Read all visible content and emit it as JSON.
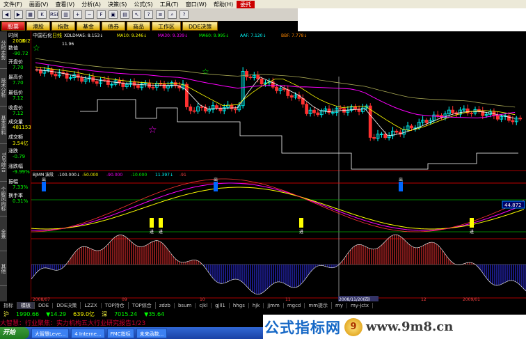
{
  "menubar": {
    "items": [
      "文件(F)",
      "画面(V)",
      "查看(V)",
      "分析(A)",
      "决策(S)",
      "公式(S)",
      "工具(T)",
      "窗口(W)",
      "帮助(H)",
      "委托"
    ],
    "active_index": 9
  },
  "toolbar": {
    "icons": [
      "back-icon",
      "forward-icon",
      "grid-icon",
      "kline-icon",
      "rsi-icon",
      "bar-chart-icon",
      "zoom-in-icon",
      "zoom-out-icon",
      "f10-icon",
      "screen-icon",
      "tile-icon",
      "pointer-icon",
      "news-icon",
      "calc-icon",
      "search-icon",
      "help-icon"
    ],
    "icon_labels": [
      "◀",
      "▶",
      "▦",
      "K",
      "RSI",
      "▥",
      "+",
      "−",
      "F",
      "▣",
      "▤",
      "↖",
      "?",
      "≡",
      "⌕",
      "?"
    ]
  },
  "tabs": {
    "items": [
      "股票",
      "港股",
      "指数",
      "基金",
      "债券",
      "商品",
      "工作区",
      "DDE决策"
    ],
    "active_index": 0
  },
  "leftpanel": {
    "rows": [
      {
        "label": "时间",
        "value": "2008"
      },
      {
        "label": "",
        "value": "10/27"
      },
      {
        "label": "数值",
        "value": "-90.72"
      },
      {
        "label": "开盘价",
        "value": "7.70"
      },
      {
        "label": "最高价",
        "value": "7.70"
      },
      {
        "label": "最低价",
        "value": "7.12"
      },
      {
        "label": "收盘价",
        "value": "7.12"
      },
      {
        "label": "成交量",
        "value": "481153"
      },
      {
        "label": "成交额",
        "value": "3.54亿"
      },
      {
        "label": "涨跌",
        "value": "-0.79"
      },
      {
        "label": "涨跌幅",
        "value": "-9.99%"
      },
      {
        "label": "振幅",
        "value": "7.33%"
      },
      {
        "label": "换手率",
        "value": "0.31%"
      }
    ],
    "side_tabs": [
      "分时走势",
      "技术分析",
      "基本资料",
      "TOP综合",
      "个股风向标",
      "全景",
      "其他"
    ]
  },
  "price_panel": {
    "stock": "中国石化",
    "period": "日线",
    "method": "XDLD",
    "ma_labels": [
      "MA5: 8.153↓",
      "MA10: 9.246↓",
      "MA30: 9.339↓",
      "MA60: 9.995↓",
      "AAF: 7.120↓",
      "BBF: 7.778↓"
    ],
    "annotation_high": "11.96",
    "annotation_low": "7.12",
    "colors": {
      "up": "#00ffff",
      "down": "#ff3030",
      "ma5": "#ffffff",
      "ma10": "#ffff00",
      "ma30": "#ff00ff",
      "ma60": "#00ff00"
    }
  },
  "osc_panel": {
    "name": "BJMM",
    "param": "波段",
    "levels": [
      "-100.000↓",
      "-50.000",
      "-90.000",
      "-10.000",
      "11.397↓",
      "-91"
    ],
    "sell_label": "出",
    "buy_label": "进",
    "right_value": "44.872"
  },
  "hist_panel": {
    "left_value": "-34.34",
    "scale_low": "-100.00"
  },
  "date_axis": {
    "labels": [
      "2008/07",
      "09",
      "10",
      "11",
      "2008/11/20(四)",
      "12",
      "2009/01"
    ],
    "cursor_date": "2008/11/20(四)"
  },
  "bottomtabs": {
    "items": [
      "指标",
      "模板",
      "DDE",
      "DDE决策",
      "LZZX",
      "TOP持仓",
      "TOP综合",
      "zdzb",
      "bsum",
      "cjkl",
      "gjll1",
      "hhgs",
      "hjk",
      "jjmm",
      "mgcd",
      "mm提示",
      "my",
      "my-jctx"
    ],
    "active_index": 1
  },
  "quotebar": {
    "market1": "沪",
    "index1": "1990.66",
    "change1": "▼14.29",
    "amount1": "639.0亿",
    "market2": "深",
    "index2": "7015.24",
    "change2": "▼35.64"
  },
  "newsbar": {
    "text": "大智慧：行业聚焦：实力机构五大行业研究报告1/23"
  },
  "taskbar": {
    "start": "开始",
    "tasks": [
      "大智慧Leve...",
      "4 Interne...",
      "FMC指标",
      "未来函数..."
    ]
  },
  "watermark": {
    "site_name": "公式指标网",
    "coin": "9",
    "url": "www.9m8.cn"
  }
}
